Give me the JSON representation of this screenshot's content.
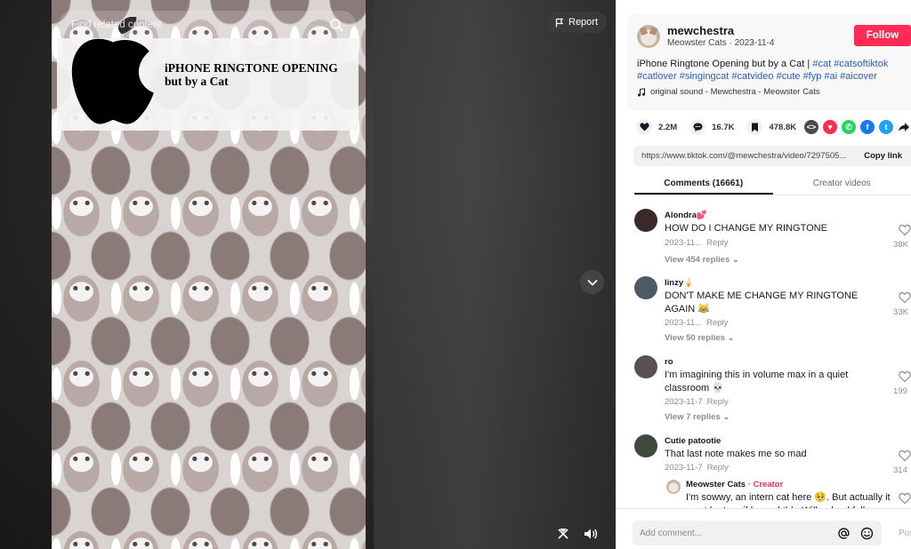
{
  "video": {
    "search_placeholder": "Find related content",
    "overlay_title": "iPHONE RINGTONE OPENING\nbut by a Cat",
    "report_label": "Report",
    "icons": {
      "search": "search-icon",
      "report": "flag-icon",
      "next": "chevron-down-icon",
      "floating": "floating-player-icon",
      "volume": "volume-icon",
      "logo": "apple-logo"
    }
  },
  "author": {
    "username": "mewchestra",
    "nickname": "Meowster Cats",
    "separator": " · ",
    "date": "2023-11-4",
    "follow_label": "Follow"
  },
  "description": {
    "text": "iPhone Ringtone Opening but by a Cat | ",
    "hashtags": [
      "#cat",
      "#catsoftiktok",
      "#catlover",
      "#singingcat",
      "#catvideo",
      "#cute",
      "#fyp",
      "#ai",
      "#aicover"
    ]
  },
  "music": {
    "label": "original sound - Mewchestra - Meowster Cats"
  },
  "stats": {
    "likes": "2.2M",
    "comments": "16.7K",
    "saves": "478.8K"
  },
  "share": {
    "platforms": [
      {
        "name": "embed",
        "color": "#4a4a4a",
        "glyph": "<>"
      },
      {
        "name": "send-to-friends",
        "color": "#fe2c55",
        "glyph": "▾"
      },
      {
        "name": "whatsapp",
        "color": "#25d366",
        "glyph": "✆"
      },
      {
        "name": "facebook",
        "color": "#1877f2",
        "glyph": "f"
      },
      {
        "name": "twitter",
        "color": "#1da1f2",
        "glyph": "t"
      }
    ]
  },
  "link": {
    "url": "https://www.tiktok.com/@mewchestra/video/7297505...",
    "copy_label": "Copy link"
  },
  "tabs": {
    "comments": "Comments (16661)",
    "creator_videos": "Creator videos"
  },
  "comments": [
    {
      "name": "Alondra💕",
      "text": "HOW DO I CHANGE MY RINGTONE",
      "date": "2023-11...",
      "reply": "Reply",
      "replies": "View 454 replies",
      "likes": "38K",
      "avatar_color": "#3a2a2a"
    },
    {
      "name": "linzy🍦",
      "text": "DON'T MAKE ME CHANGE MY RINGTONE AGAIN 😹",
      "date": "2023-11...",
      "reply": "Reply",
      "replies": "View 50 replies",
      "likes": "33K",
      "avatar_color": "#4d5a66"
    },
    {
      "name": "ro",
      "text": "I'm imagining this in volume max in a quiet classroom 💀",
      "date": "2023-11-7",
      "reply": "Reply",
      "replies": "View 7 replies",
      "likes": "199",
      "avatar_color": "#5b4f56"
    },
    {
      "name": "Cutie patootie",
      "text": "That last note makes me so mad",
      "date": "2023-11-7",
      "reply": "Reply",
      "likes": "314",
      "avatar_color": "#3f4a3c"
    }
  ],
  "creator_reply": {
    "name": "Meowster Cats",
    "badge": " · Creator",
    "text": "I'm sowwy, an intern cat here 🥺. But actually it must be true if leaned tbh. Will upload full"
  },
  "comment_input": {
    "placeholder": "Add comment...",
    "post_label": "Pos"
  }
}
